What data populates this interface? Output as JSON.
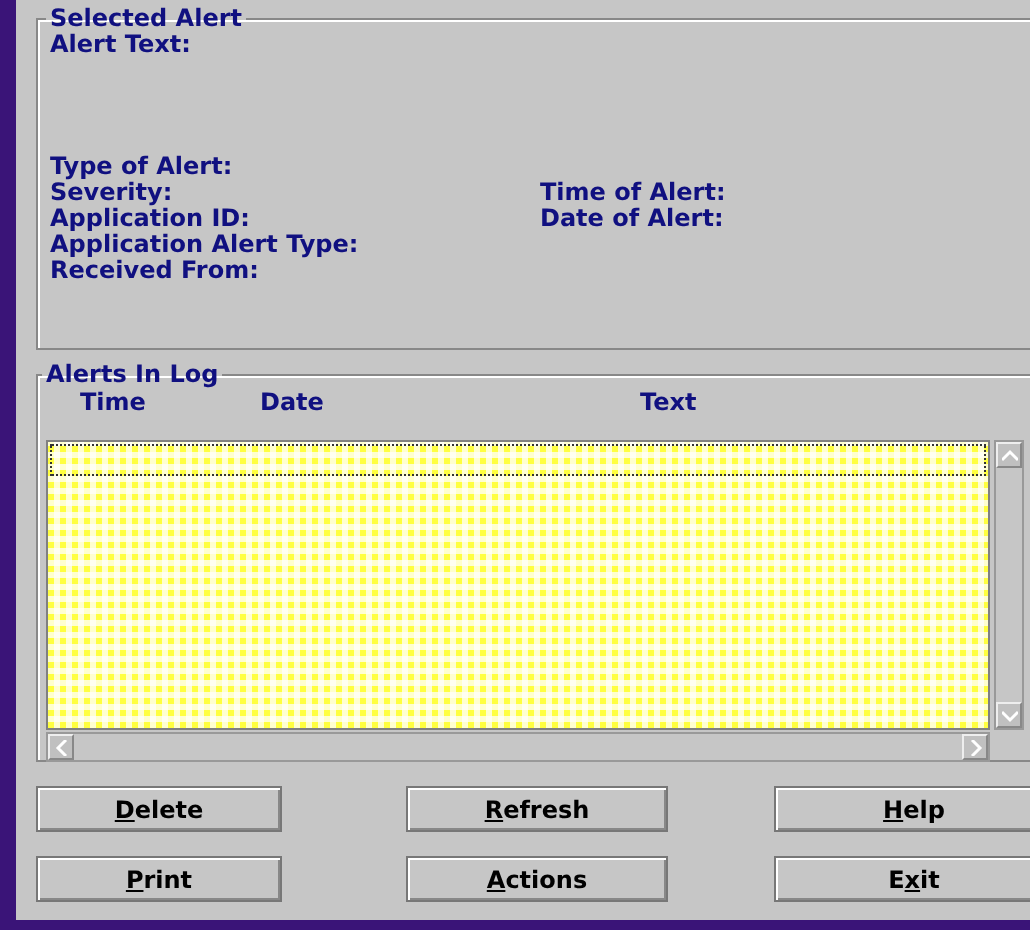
{
  "selected_alert": {
    "title": "Selected Alert",
    "alert_text_label": "Alert Text:",
    "left_fields": [
      "Type of Alert:",
      "Severity:",
      "Application ID:",
      "Application Alert Type:",
      "Received From:"
    ],
    "right_fields": [
      "Time of Alert:",
      "Date of Alert:"
    ]
  },
  "alerts_in_log": {
    "title": "Alerts In Log",
    "columns": [
      "Time",
      "Date",
      "Text"
    ]
  },
  "buttons": [
    {
      "access_key": "D",
      "after": "elete"
    },
    {
      "access_key": "R",
      "after": "efresh"
    },
    {
      "access_key": "H",
      "after": "elp"
    },
    {
      "access_key": "P",
      "after": "rint"
    },
    {
      "access_key": "A",
      "after": "ctions"
    },
    {
      "before": "E",
      "access_key": "x",
      "after": "it"
    }
  ]
}
